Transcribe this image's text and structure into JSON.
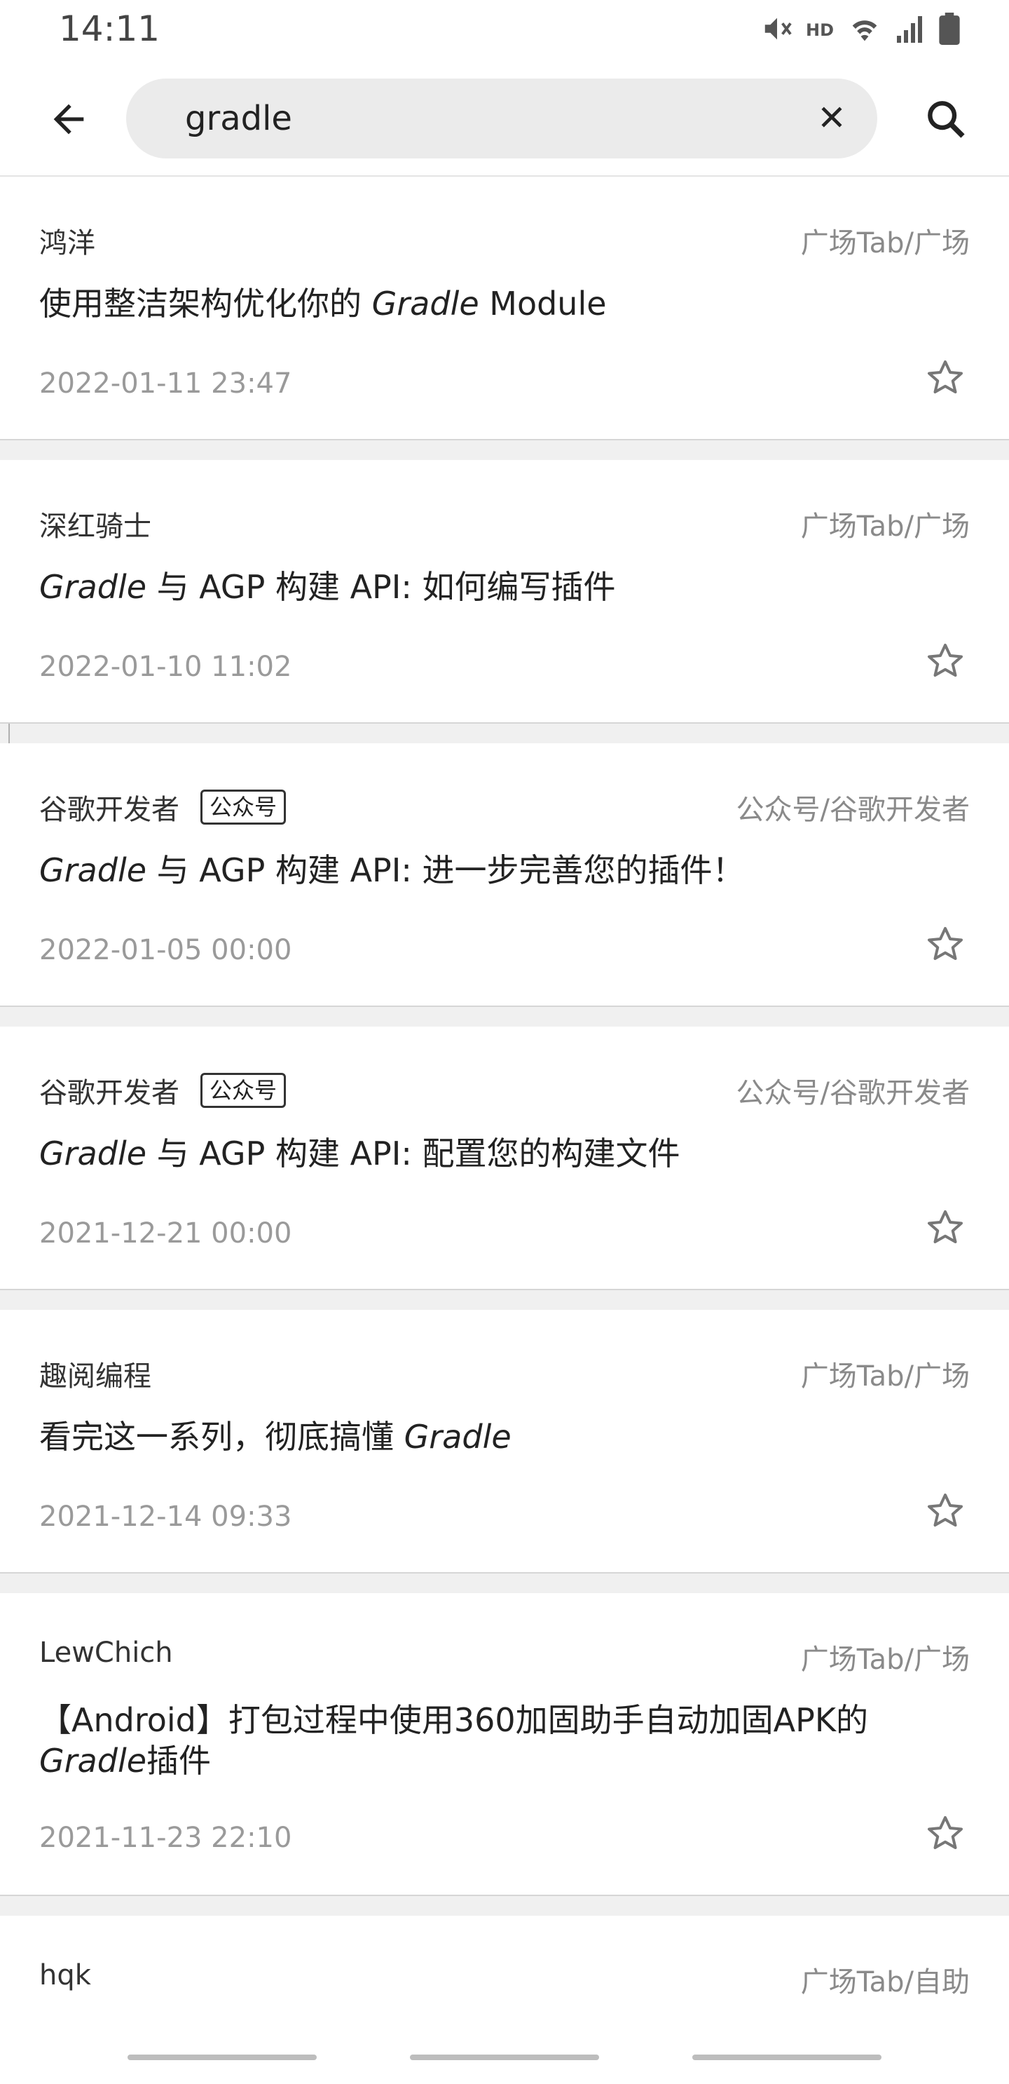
{
  "status_bar": {
    "time": "14:11",
    "hd_label": "HD",
    "icons": [
      "mute-icon",
      "wifi-icon",
      "signal-icon",
      "battery-icon"
    ]
  },
  "search": {
    "value": "gradle",
    "placeholder": ""
  },
  "icons": {
    "back": "arrow-left-icon",
    "clear": "close-icon",
    "search": "search-icon",
    "star": "star-outline-icon"
  },
  "colors": {
    "date": "#9a9a9a",
    "chapter": "#8a8a8a",
    "background": "#f0f0f0"
  },
  "articles": [
    {
      "author": "鸿洋",
      "chapter": "广场Tab/广场",
      "title_pre": "使用整洁架构优化你的 ",
      "title_em": "Gradle",
      "title_post": " Module",
      "date": "2022-01-11 23:47"
    },
    {
      "author": "深红骑士",
      "chapter": "广场Tab/广场",
      "title_pre": "",
      "title_em": "Gradle",
      "title_post": " 与 AGP 构建 API: 如何编写插件",
      "date": "2022-01-10 11:02"
    },
    {
      "author": "谷歌开发者",
      "badge": "公众号",
      "chapter": "公众号/谷歌开发者",
      "title_pre": "",
      "title_em": "Gradle",
      "title_post": " 与 AGP 构建 API: 进一步完善您的插件！",
      "date": "2022-01-05 00:00"
    },
    {
      "author": "谷歌开发者",
      "badge": "公众号",
      "chapter": "公众号/谷歌开发者",
      "title_pre": "",
      "title_em": "Gradle",
      "title_post": " 与 AGP 构建 API: 配置您的构建文件",
      "date": "2021-12-21 00:00"
    },
    {
      "author": "趣阅编程",
      "chapter": "广场Tab/广场",
      "title_pre": "看完这一系列，彻底搞懂 ",
      "title_em": "Gradle",
      "title_post": "",
      "date": "2021-12-14 09:33"
    },
    {
      "author": "LewChich",
      "chapter": "广场Tab/广场",
      "title_pre": "【Android】打包过程中使用360加固助手自动加固APK的",
      "title_em": "Gradle",
      "title_post": "插件",
      "date": "2021-11-23 22:10"
    },
    {
      "author": "hqk",
      "chapter": "广场Tab/自助",
      "title_pre": "",
      "title_em": "",
      "title_post": "",
      "date": ""
    }
  ]
}
